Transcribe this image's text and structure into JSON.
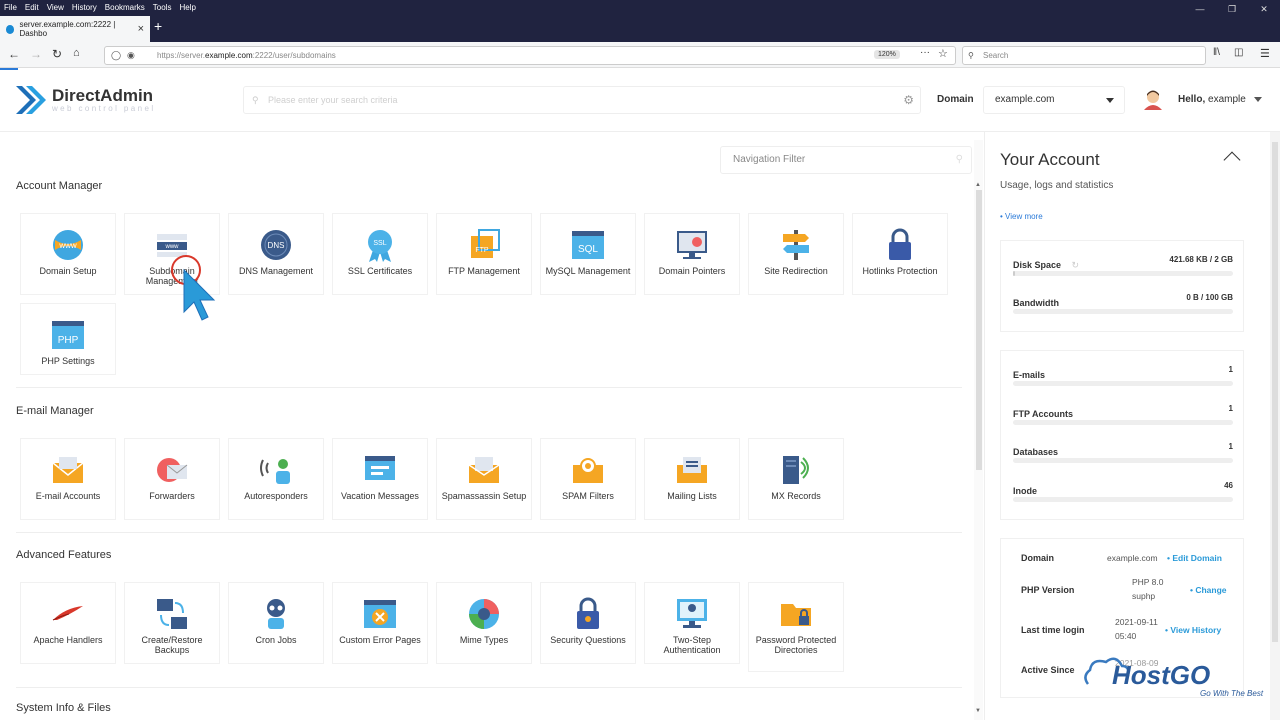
{
  "browser": {
    "menu": [
      "File",
      "Edit",
      "View",
      "History",
      "Bookmarks",
      "Tools",
      "Help"
    ],
    "tab_title": "server.example.com:2222 | Dashbo",
    "url_prefix": "https://server.",
    "url_domain": "example.com",
    "url_rest": ":2222/user/subdomains",
    "zoom": "120%",
    "search_placeholder": "Search"
  },
  "app": {
    "logo_name": "DirectAdmin",
    "logo_tagline": "web control panel",
    "search_placeholder": "Please enter your search criteria",
    "domain_label": "Domain",
    "domain_value": "example.com",
    "hello_prefix": "Hello,",
    "hello_user": "example"
  },
  "main": {
    "nav_filter_placeholder": "Navigation Filter",
    "sections": {
      "account": "Account Manager",
      "email": "E-mail Manager",
      "advanced": "Advanced Features",
      "system": "System Info & Files"
    },
    "account_items": [
      "Domain Setup",
      "Subdomain Management",
      "DNS Management",
      "SSL Certificates",
      "FTP Management",
      "MySQL Management",
      "Domain Pointers",
      "Site Redirection",
      "Hotlinks Protection",
      "PHP Settings"
    ],
    "email_items": [
      "E-mail Accounts",
      "Forwarders",
      "Autoresponders",
      "Vacation Messages",
      "Spamassassin Setup",
      "SPAM Filters",
      "Mailing Lists",
      "MX Records"
    ],
    "advanced_items": [
      "Apache Handlers",
      "Create/Restore Backups",
      "Cron Jobs",
      "Custom Error Pages",
      "Mime Types",
      "Security Questions",
      "Two-Step Authentication",
      "Password Protected Directories"
    ]
  },
  "sidebar": {
    "title": "Your Account",
    "subtitle": "Usage, logs and statistics",
    "view_more": "• View more",
    "disk_label": "Disk Space",
    "disk_value": "421.68 KB / 2 GB",
    "disk_fraction": 0.0002,
    "bandwidth_label": "Bandwidth",
    "bandwidth_value": "0 B / 100 GB",
    "emails_label": "E-mails",
    "emails_value": "1",
    "ftp_label": "FTP Accounts",
    "ftp_value": "1",
    "db_label": "Databases",
    "db_value": "1",
    "inode_label": "Inode",
    "inode_value": "46",
    "info": {
      "domain_label": "Domain",
      "domain_value": "example.com",
      "domain_link": "• Edit Domain",
      "php_label": "PHP Version",
      "php_value_1": "PHP 8.0",
      "php_value_2": "suphp",
      "php_link": "• Change",
      "login_label": "Last time login",
      "login_date": "2021-09-11",
      "login_time": "05:40",
      "login_link": "• View History",
      "active_label": "Active Since",
      "active_value": "2021-08-09"
    }
  },
  "watermark": {
    "brand": "HostGO",
    "slogan": "Go With The Best"
  }
}
